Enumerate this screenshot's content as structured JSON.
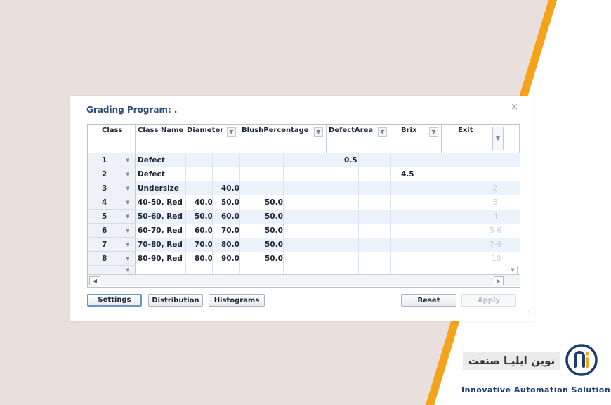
{
  "dialog": {
    "title": "Grading Program: .",
    "close_glyph": "×"
  },
  "columns": [
    {
      "label": "Class",
      "has_dropdown": false
    },
    {
      "label": "Class Name",
      "has_dropdown": false
    },
    {
      "label": "Diameter",
      "has_dropdown": true
    },
    {
      "label": "BlushPercentage",
      "has_dropdown": true
    },
    {
      "label": "DefectArea",
      "has_dropdown": true
    },
    {
      "label": "Brix",
      "has_dropdown": true
    },
    {
      "label": "Exit",
      "has_dropdown": true
    }
  ],
  "rows": [
    {
      "class": "1",
      "class_name": "Defect",
      "diam_min": "",
      "diam_max": "",
      "blush_min": "",
      "defect_min": "0.5",
      "brix_min": "",
      "exit": ""
    },
    {
      "class": "2",
      "class_name": "Defect",
      "diam_min": "",
      "diam_max": "",
      "blush_min": "",
      "defect_min": "",
      "brix_min": "4.5",
      "exit": ""
    },
    {
      "class": "3",
      "class_name": "Undersize",
      "diam_min": "",
      "diam_max": "40.0",
      "blush_min": "",
      "defect_min": "",
      "brix_min": "",
      "exit": "2"
    },
    {
      "class": "4",
      "class_name": "40-50, Red",
      "diam_min": "40.0",
      "diam_max": "50.0",
      "blush_min": "50.0",
      "defect_min": "",
      "brix_min": "",
      "exit": "3"
    },
    {
      "class": "5",
      "class_name": "50-60, Red",
      "diam_min": "50.0",
      "diam_max": "60.0",
      "blush_min": "50.0",
      "defect_min": "",
      "brix_min": "",
      "exit": "4"
    },
    {
      "class": "6",
      "class_name": "60-70, Red",
      "diam_min": "60.0",
      "diam_max": "70.0",
      "blush_min": "50.0",
      "defect_min": "",
      "brix_min": "",
      "exit": "5-6"
    },
    {
      "class": "7",
      "class_name": "70-80, Red",
      "diam_min": "70.0",
      "diam_max": "80.0",
      "blush_min": "50.0",
      "defect_min": "",
      "brix_min": "",
      "exit": "7-9"
    },
    {
      "class": "8",
      "class_name": "80-90, Red",
      "diam_min": "80.0",
      "diam_max": "90.0",
      "blush_min": "50.0",
      "defect_min": "",
      "brix_min": "",
      "exit": "10"
    }
  ],
  "buttons": {
    "settings": "Settings",
    "distribution": "Distribution",
    "histograms": "Histograms",
    "reset": "Reset",
    "apply": "Apply"
  },
  "brand": {
    "name_fa": "نوین ایلیـا صنعت",
    "tagline": "Innovative Automation Solutions",
    "colors": {
      "accent": "#f5a31a",
      "navy": "#1c3d6e",
      "bg": "#e9dfdc"
    }
  }
}
